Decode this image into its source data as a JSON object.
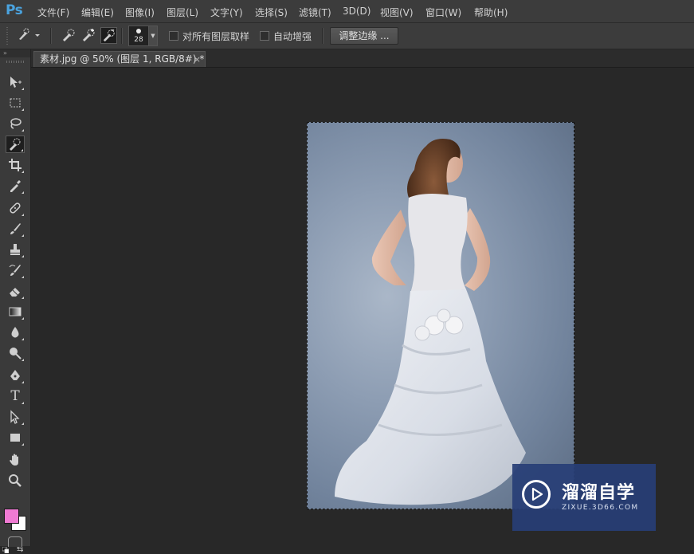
{
  "app": {
    "logo": "Ps"
  },
  "menu": {
    "items": [
      "文件(F)",
      "编辑(E)",
      "图像(I)",
      "图层(L)",
      "文字(Y)",
      "选择(S)",
      "滤镜(T)",
      "3D(D)",
      "视图(V)",
      "窗口(W)",
      "帮助(H)"
    ]
  },
  "options": {
    "brush_size": "28",
    "sample_all_layers_label": "对所有图层取样",
    "sample_all_layers_checked": false,
    "auto_enhance_label": "自动增强",
    "auto_enhance_checked": false,
    "refine_edge_label": "调整边缘 ..."
  },
  "document": {
    "tab_title": "素材.jpg @ 50% (图层 1, RGB/8#) *",
    "close_glyph": "×"
  },
  "toolbox": {
    "tools": [
      "move-tool",
      "rectangular-marquee-tool",
      "lasso-tool",
      "quick-selection-tool",
      "crop-tool",
      "eyedropper-tool",
      "spot-healing-brush-tool",
      "brush-tool",
      "clone-stamp-tool",
      "history-brush-tool",
      "eraser-tool",
      "gradient-tool",
      "blur-tool",
      "dodge-tool",
      "pen-tool",
      "type-tool",
      "path-selection-tool",
      "rectangle-tool",
      "hand-tool",
      "zoom-tool"
    ],
    "active_tool": "quick-selection-tool",
    "foreground_color": "#f07ad3",
    "background_color": "#ffffff"
  },
  "watermark": {
    "title": "溜溜自学",
    "url": "ZIXUE.3D66.COM"
  },
  "colors": {
    "ui_background": "#282828",
    "panel": "#3c3c3c",
    "ps_blue": "#4aa3df"
  }
}
